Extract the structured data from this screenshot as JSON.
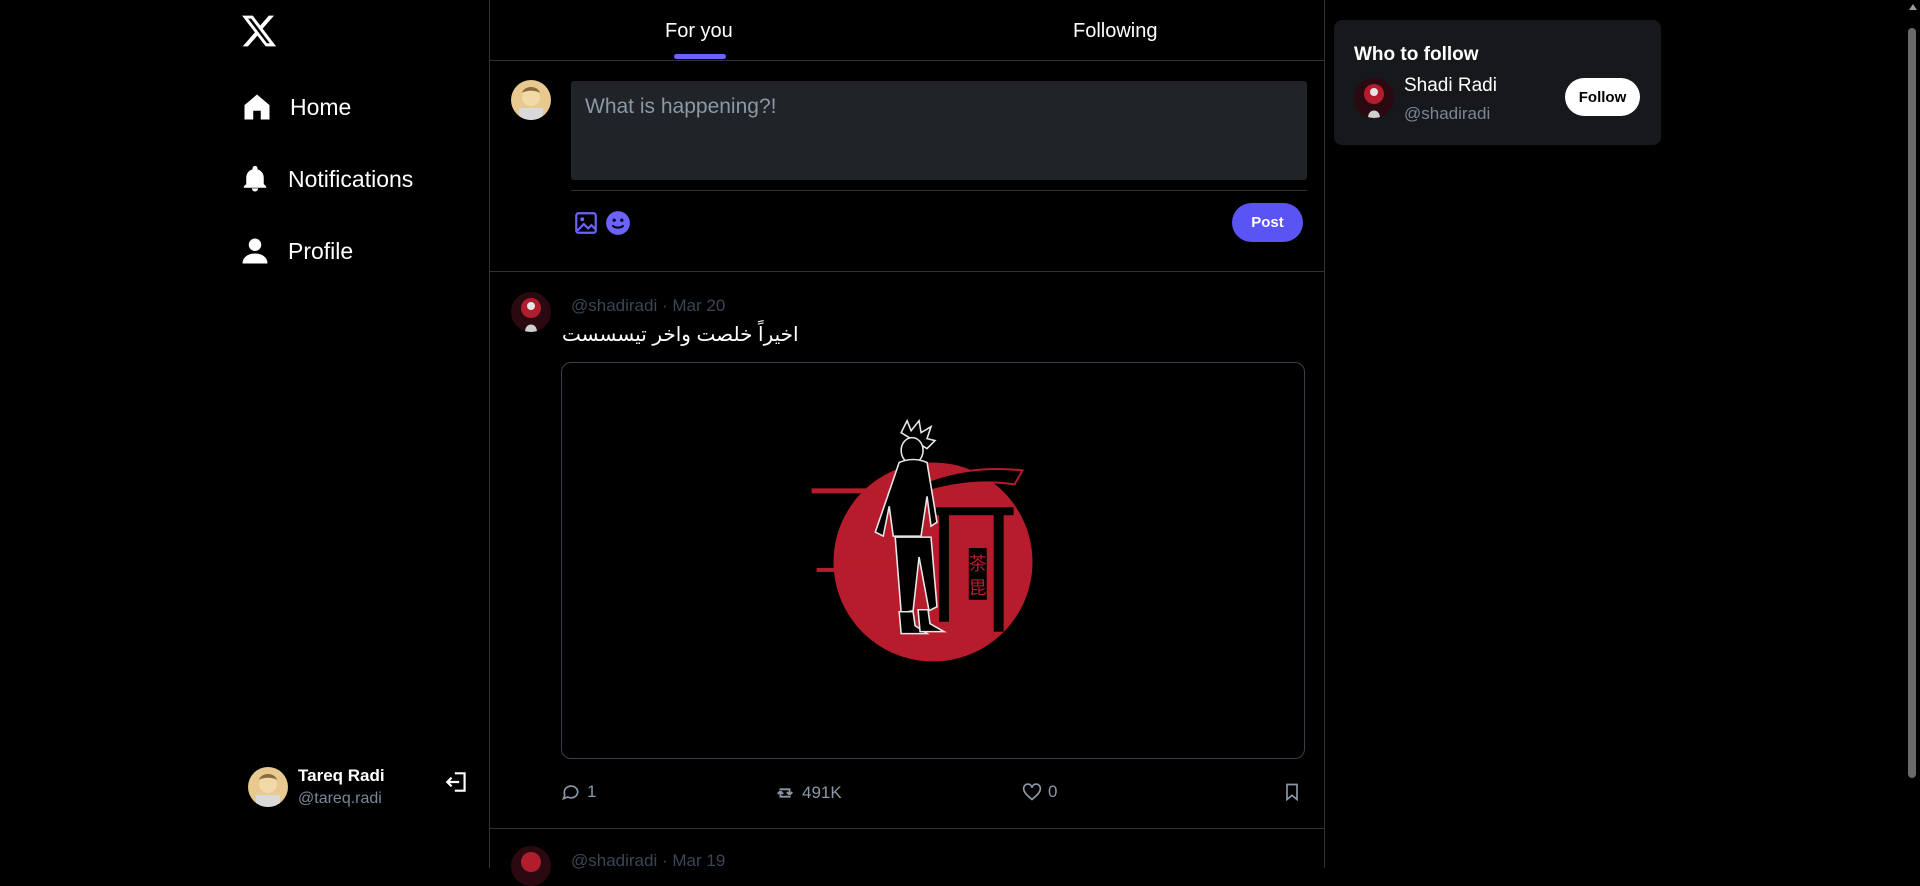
{
  "colors": {
    "accent": "#5b54f5",
    "background": "#000000",
    "panel": "#16181c",
    "input_bg": "#202327",
    "muted": "#7b8699"
  },
  "sidebar": {
    "logo_icon": "x-logo-icon",
    "nav": [
      {
        "label": "Home",
        "icon": "home-icon"
      },
      {
        "label": "Notifications",
        "icon": "bell-icon"
      },
      {
        "label": "Profile",
        "icon": "user-icon"
      }
    ],
    "current_user": {
      "name": "Tareq Radi",
      "handle": "@tareq.radi"
    },
    "logout_icon": "logout-icon"
  },
  "feed": {
    "tabs": [
      {
        "label": "For you",
        "active": true
      },
      {
        "label": "Following",
        "active": false
      }
    ],
    "composer": {
      "placeholder": "What is happening?!",
      "post_label": "Post",
      "media_icon": "image-icon",
      "emoji_icon": "emoji-icon"
    },
    "tweets": [
      {
        "handle": "@shadiradi",
        "date": "Mar 20",
        "text": "اخيراً خلصت واخر تيسسست",
        "replies": "1",
        "reposts": "491K",
        "likes": "0"
      },
      {
        "handle": "@shadiradi",
        "date": "Mar 19"
      }
    ]
  },
  "who_to_follow": {
    "title": "Who to follow",
    "users": [
      {
        "name": "Shadi Radi",
        "handle": "@shadiradi",
        "button_label": "Follow"
      }
    ]
  }
}
